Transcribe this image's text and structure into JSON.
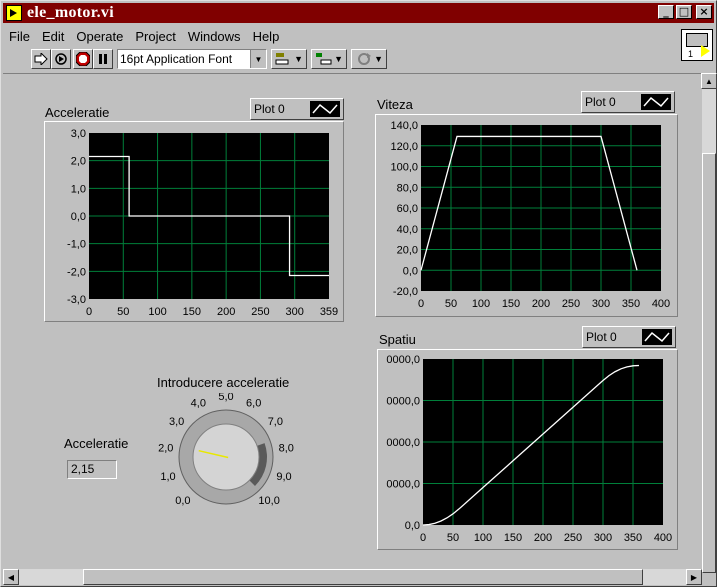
{
  "window": {
    "title": "ele_motor.vi"
  },
  "window_controls": {
    "minimize": "_",
    "maximize": "□",
    "close": "×"
  },
  "menu": [
    "File",
    "Edit",
    "Operate",
    "Project",
    "Windows",
    "Help"
  ],
  "toolbar": {
    "font": "16pt Application Font"
  },
  "vi_icon": {
    "number": "1"
  },
  "graphs": {
    "acceleratie": {
      "label": "Acceleratie",
      "legend": "Plot 0",
      "y_ticks": [
        "3,0",
        "2,0",
        "1,0",
        "0,0",
        "-1,0",
        "-2,0",
        "-3,0"
      ],
      "x_ticks": [
        "0",
        "50",
        "100",
        "150",
        "200",
        "250",
        "300",
        "359"
      ]
    },
    "viteza": {
      "label": "Viteza",
      "legend": "Plot 0",
      "y_ticks": [
        "140,0",
        "120,0",
        "100,0",
        "80,0",
        "60,0",
        "40,0",
        "20,0",
        "0,0",
        "-20,0"
      ],
      "x_ticks": [
        "0",
        "50",
        "100",
        "150",
        "200",
        "250",
        "300",
        "350",
        "400"
      ]
    },
    "spatiu": {
      "label": "Spatiu",
      "legend": "Plot 0",
      "y_ticks": [
        "0000,0",
        "0000,0",
        "0000,0",
        "0000,0",
        "0,0"
      ],
      "x_ticks": [
        "0",
        "50",
        "100",
        "150",
        "200",
        "250",
        "300",
        "350",
        "400"
      ]
    }
  },
  "knob": {
    "label": "Introducere acceleratie",
    "value": 2.15,
    "scale": [
      "0,0",
      "1,0",
      "2,0",
      "3,0",
      "4,0",
      "5,0",
      "6,0",
      "7,0",
      "8,0",
      "9,0",
      "10,0"
    ]
  },
  "indicator": {
    "label": "Acceleratie",
    "value": "2,15"
  },
  "chart_data": [
    {
      "type": "line",
      "title": "Acceleratie",
      "xlim": [
        0,
        359
      ],
      "ylim": [
        -3,
        3
      ],
      "series": [
        {
          "x": [
            0,
            60,
            60,
            300,
            300,
            359
          ],
          "values": [
            2.15,
            2.15,
            0,
            0,
            -2.15,
            -2.15
          ]
        }
      ]
    },
    {
      "type": "line",
      "title": "Viteza",
      "xlim": [
        0,
        400
      ],
      "ylim": [
        -20,
        140
      ],
      "series": [
        {
          "x": [
            0,
            60,
            300,
            360
          ],
          "values": [
            0,
            129,
            129,
            0
          ]
        }
      ]
    },
    {
      "type": "line",
      "title": "Spatiu",
      "xlim": [
        0,
        400
      ],
      "ylim": [
        0,
        40000
      ],
      "series": [
        {
          "x": [
            0,
            10,
            20,
            30,
            40,
            50,
            60,
            100,
            150,
            200,
            250,
            300,
            310,
            320,
            330,
            340,
            350,
            360
          ],
          "values": [
            0,
            108,
            430,
            968,
            1720,
            2688,
            3870,
            9030,
            15480,
            21930,
            28380,
            34830,
            35990,
            36930,
            37640,
            38100,
            38360,
            38440
          ]
        }
      ]
    }
  ]
}
